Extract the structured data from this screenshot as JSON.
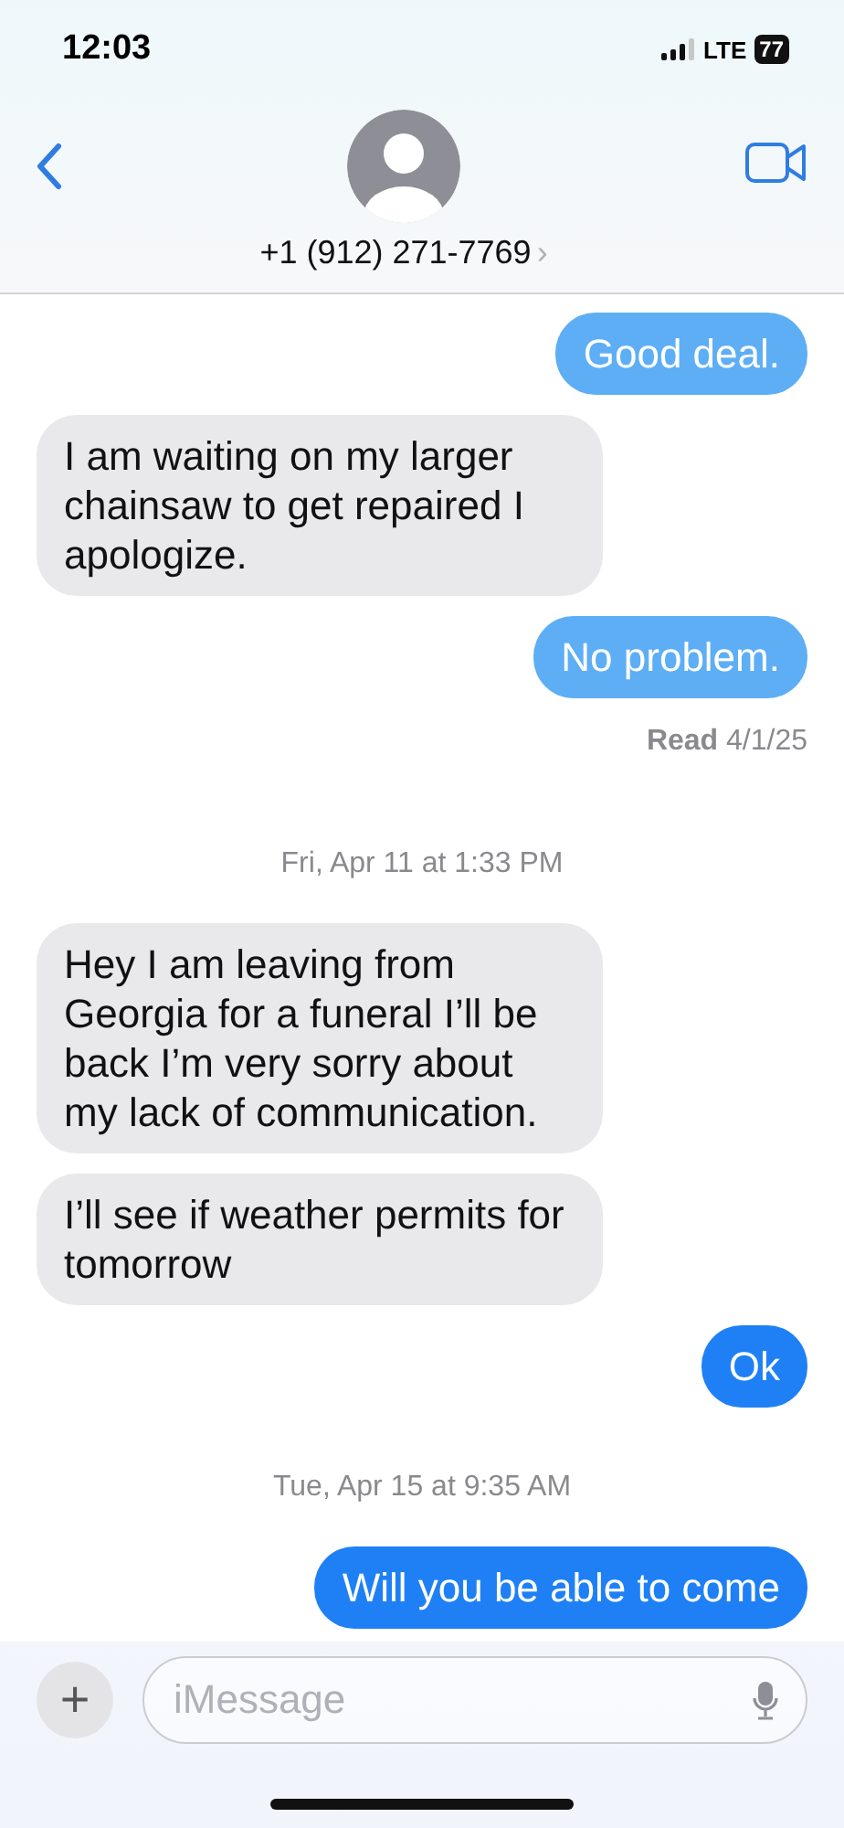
{
  "status_bar": {
    "time": "12:03",
    "network": "LTE",
    "battery": "77"
  },
  "header": {
    "contact": "+1 (912) 271-7769",
    "chevron": "›"
  },
  "messages": [
    {
      "kind": "sent",
      "text": "Good deal.",
      "color": "#5eaef5"
    },
    {
      "kind": "received",
      "text": "I am waiting on my larger chainsaw to get repaired I apologize."
    },
    {
      "kind": "sent",
      "text": "No problem.",
      "color": "#5eaef5"
    },
    {
      "kind": "read",
      "text": "**Read** 4/1/25"
    },
    {
      "kind": "timestamp",
      "text": "Fri, Apr 11 at 1:33 PM"
    },
    {
      "kind": "received",
      "text": "Hey I am leaving from Georgia for a funeral I’ll be back I’m very sorry about my lack of communication."
    },
    {
      "kind": "received",
      "text": "I’ll see if weather permits for tomorrow"
    },
    {
      "kind": "sent",
      "text": "Ok",
      "color": "#1f80f5"
    },
    {
      "kind": "timestamp",
      "text": "Tue, Apr 15 at 9:35 AM"
    },
    {
      "kind": "sent",
      "text": "Will you be able to come",
      "color": "#1f80f5"
    }
  ],
  "composer": {
    "plus": "+",
    "placeholder": "iMessage"
  }
}
